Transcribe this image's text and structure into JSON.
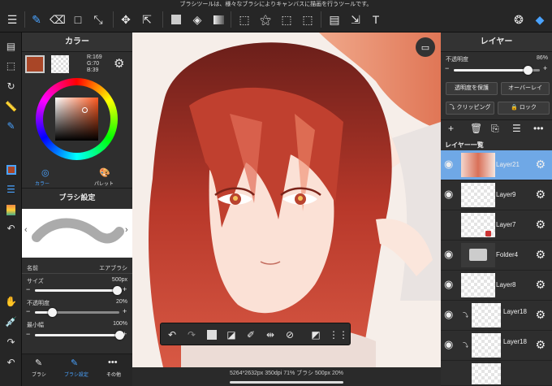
{
  "tooltip": "ブラシツールは、様々なブラシによりキャンバスに描画を行うツールです。",
  "color_panel": {
    "title": "カラー",
    "rgb": {
      "r": "R:169",
      "g": "G:70",
      "b": "B:39"
    },
    "current_color": "#a94627",
    "tabs": [
      {
        "label": "カラー"
      },
      {
        "label": "パレット"
      }
    ]
  },
  "brush_panel": {
    "title": "ブラシ設定",
    "name_label": "名前",
    "name_value": "エアブラシ",
    "size_label": "サイズ",
    "size_value": "500px",
    "size_level": 0.97,
    "opacity_label": "不透明度",
    "opacity_value": "20%",
    "opacity_level": 0.2,
    "min_width_label": "最小幅",
    "min_width_value": "100%",
    "min_width_level": 1.0,
    "bottom_tabs": [
      {
        "label": "ブラシ"
      },
      {
        "label": "ブラシ設定"
      },
      {
        "label": "その他"
      }
    ]
  },
  "status_bar": "5264*2632px 350dpi 71% ブラシ 500px 20%",
  "layer_panel": {
    "title": "レイヤー",
    "opacity_label": "不透明度",
    "opacity_value": "86%",
    "opacity_level": 0.86,
    "protect_label": "透明度を保護",
    "blend_label": "オーバーレイ",
    "clip_label": "クリッピング",
    "lock_label": "ロック",
    "list_title": "レイヤー一覧",
    "layers": [
      {
        "name": "Layer21",
        "selected": true
      },
      {
        "name": "Layer9",
        "selected": false
      },
      {
        "name": "Layer7",
        "selected": false
      },
      {
        "name": "Folder4",
        "selected": false
      },
      {
        "name": "Layer8",
        "selected": false
      },
      {
        "name": "Layer18",
        "selected": false
      },
      {
        "name": "Layer18",
        "selected": false
      }
    ]
  }
}
